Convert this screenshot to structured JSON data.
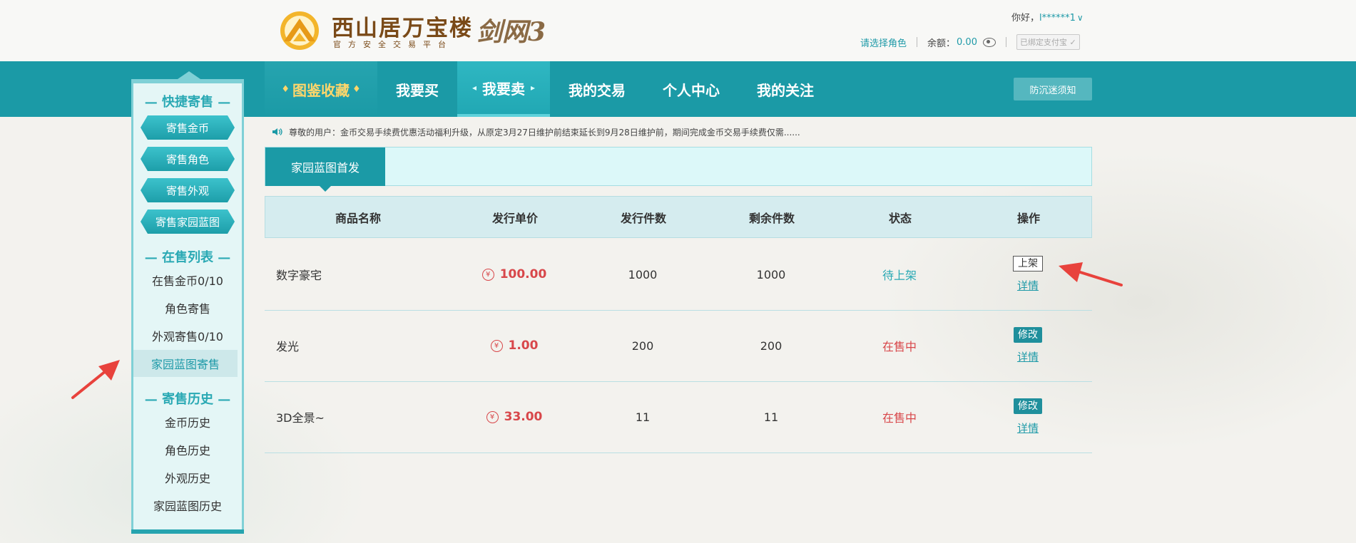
{
  "header": {
    "brand": "西山居万宝楼",
    "brand_sub": "官方安全交易平台",
    "game_logo": "剑网3",
    "greeting": "你好，",
    "username": "l******1",
    "select_role": "请选择角色",
    "balance_label": "余额：",
    "balance_value": "0.00",
    "alipay_bound": "已绑定支付宝"
  },
  "nav": {
    "items": [
      {
        "label": "图鉴收藏"
      },
      {
        "label": "我要买"
      },
      {
        "label": "我要卖"
      },
      {
        "label": "我的交易"
      },
      {
        "label": "个人中心"
      },
      {
        "label": "我的关注"
      }
    ],
    "notice_button": "防沉迷须知"
  },
  "sidebar": {
    "quick_heading": "— 快捷寄售 —",
    "quick_buttons": [
      "寄售金币",
      "寄售角色",
      "寄售外观",
      "寄售家园蓝图"
    ],
    "onsale_heading": "— 在售列表 —",
    "onsale_links": [
      "在售金币0/10",
      "角色寄售",
      "外观寄售0/10",
      "家园蓝图寄售"
    ],
    "history_heading": "— 寄售历史 —",
    "history_links": [
      "金币历史",
      "角色历史",
      "外观历史",
      "家园蓝图历史"
    ]
  },
  "ticker": {
    "text": "尊敬的用户：金币交易手续费优惠活动福利升级，从原定3月27日维护前结束延长到9月28日维护前，期间完成金币交易手续费仅需......"
  },
  "tab": {
    "label": "家园蓝图首发"
  },
  "table": {
    "headers": [
      "商品名称",
      "发行单价",
      "发行件数",
      "剩余件数",
      "状态",
      "操作"
    ],
    "currency_symbol": "¥",
    "rows": [
      {
        "name": "数字豪宅",
        "price": "100.00",
        "issued": "1000",
        "remaining": "1000",
        "status": "待上架",
        "action": "上架",
        "detail": "详情"
      },
      {
        "name": "发光",
        "price": "1.00",
        "issued": "200",
        "remaining": "200",
        "status": "在售中",
        "action": "修改",
        "detail": "详情"
      },
      {
        "name": "3D全景~",
        "price": "33.00",
        "issued": "11",
        "remaining": "11",
        "status": "在售中",
        "action": "修改",
        "detail": "详情"
      }
    ]
  },
  "colors": {
    "primary_teal": "#1b9aa6",
    "price_red": "#d8474a",
    "annotation_red": "#e8423c"
  }
}
